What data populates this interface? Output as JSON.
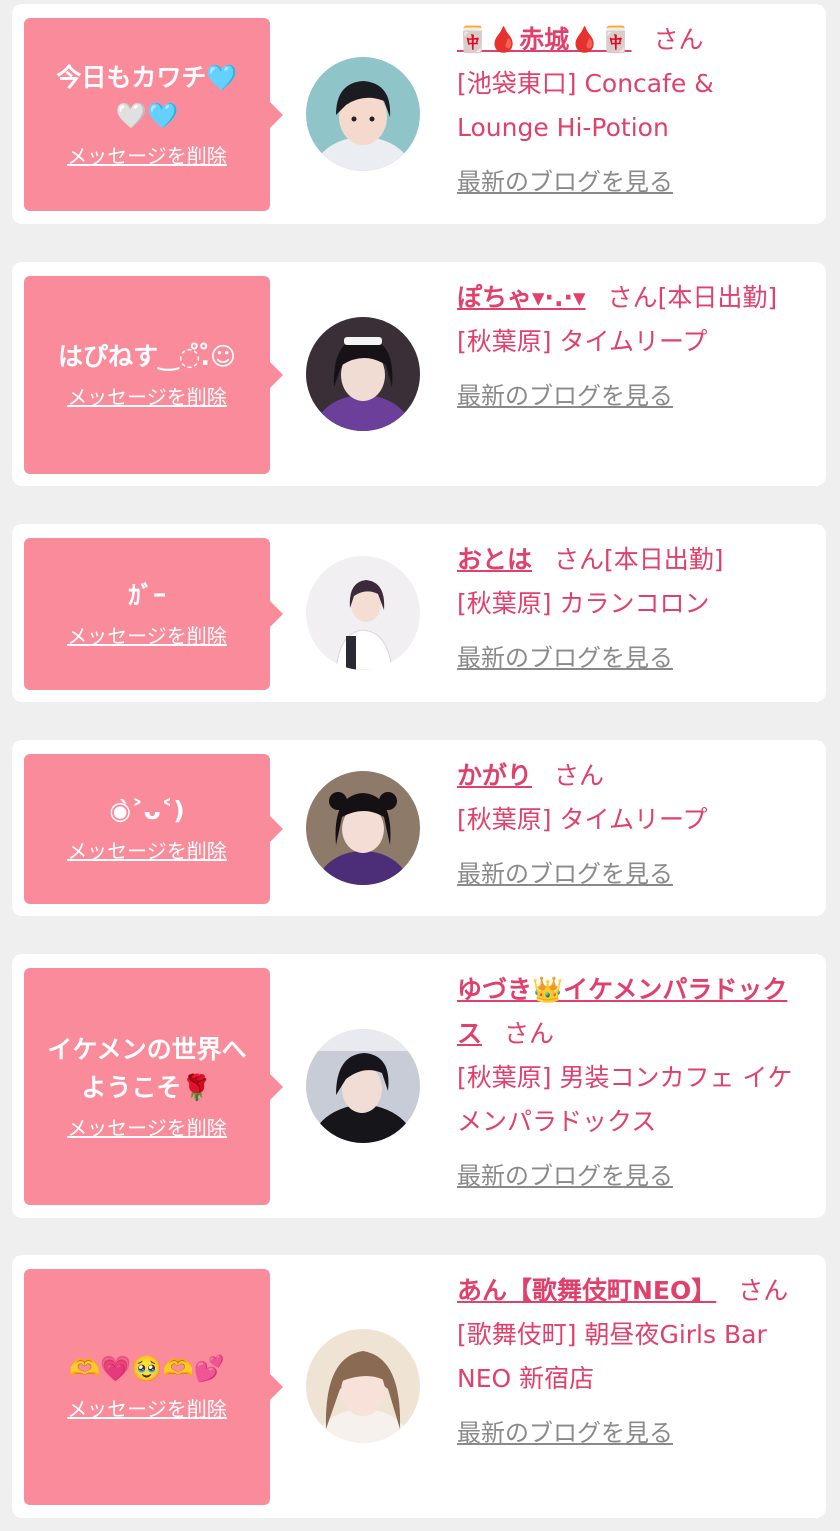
{
  "delete_label": "メッセージを削除",
  "blog_label": "最新のブログを見る",
  "honorific": "さん",
  "colors": {
    "bubble": "#f98b9b",
    "accent": "#e0406c",
    "link_gray": "#8a8a8a",
    "page_bg": "#efefef"
  },
  "entries": [
    {
      "message": "今日もカワチ🩵\n🤍🩵",
      "cast_name": "🀄🩸赤城🩸🀄",
      "attendance": "",
      "store": "[池袋東口] Concafe & Lounge Hi-Potion"
    },
    {
      "message": "はぴねす‿◌̊.̊☺",
      "cast_name": "ぽちゃ▾·.·▾",
      "attendance": "[本日出勤]",
      "store": "[秋葉原] タイムリープ"
    },
    {
      "message": "ｶﾞｰ",
      "cast_name": "おとは",
      "attendance": "[本日出勤]",
      "store": "[秋葉原] カランコロン"
    },
    {
      "message": "◉̀˃ᴗ˂)",
      "cast_name": "かがり",
      "attendance": "",
      "store": "[秋葉原] タイムリープ"
    },
    {
      "message": "イケメンの世界へ\nようこそ🌹",
      "cast_name": "ゆづき👑イケメンパラドックス",
      "attendance": "",
      "store": "[秋葉原] 男装コンカフェ イケメンパラドックス"
    },
    {
      "message": "🫶💗🥹🫶💕",
      "cast_name": "あん【歌舞伎町NEO】",
      "attendance": "",
      "store": "[歌舞伎町] 朝昼夜Girls Bar NEO 新宿店"
    }
  ]
}
